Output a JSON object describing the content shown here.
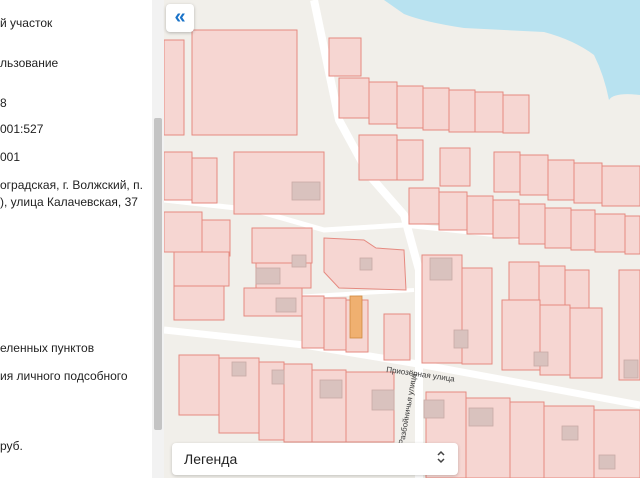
{
  "info_panel": {
    "lines": [
      "й участок",
      "льзование",
      "8",
      "001:527",
      "001",
      "оградская, г. Волжский, п.",
      "), улица Калачевская, 37",
      "еленных пунктов",
      "ия личного подсобного",
      "руб."
    ]
  },
  "map": {
    "collapse_icon": "double-chevron-left-icon",
    "collapse_glyph": "«",
    "street_labels": [
      "Приозёрная улица",
      "Разбойничья улица"
    ],
    "colors": {
      "background": "#f1efea",
      "water": "#b8e2f0",
      "plot_fill": "#f6d6d2",
      "plot_stroke": "#e58a80",
      "highlight_fill": "#d9a8d9",
      "highlight_stroke": "#8a1a9a"
    }
  },
  "legend": {
    "label": "Легенда",
    "chevron_glyph": "⌃⌄",
    "icon": "chevron-up-down-icon"
  }
}
